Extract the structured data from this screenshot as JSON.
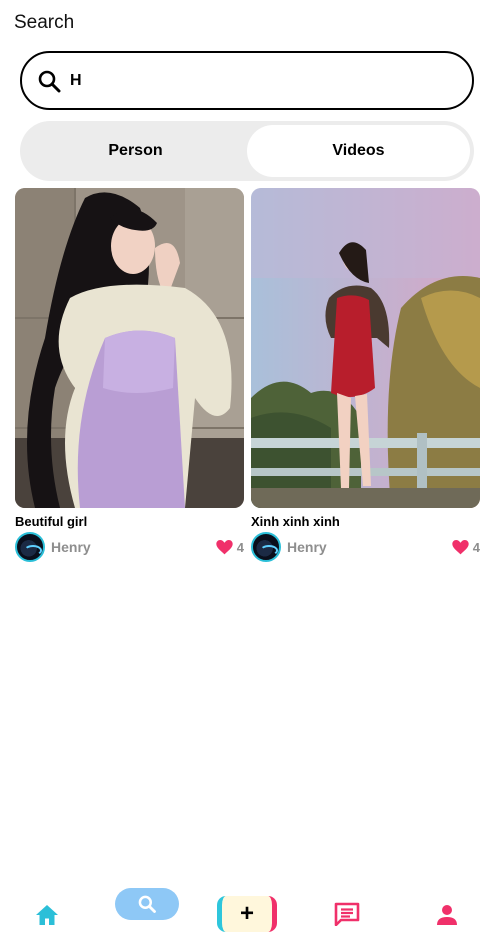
{
  "header": {
    "title": "Search"
  },
  "search": {
    "value": "H",
    "icon": "search-icon"
  },
  "tabs": [
    {
      "label": "Person",
      "active": false
    },
    {
      "label": "Videos",
      "active": true
    }
  ],
  "videos": [
    {
      "title": "Beutiful girl",
      "author": "Henry",
      "likes": "4"
    },
    {
      "title": "Xinh xinh xinh",
      "author": "Henry",
      "likes": "4"
    }
  ],
  "nav": {
    "items": [
      {
        "icon": "home-icon",
        "active": false
      },
      {
        "icon": "search-icon",
        "active": true
      },
      {
        "icon": "plus-icon",
        "glyph": "+",
        "active": false
      },
      {
        "icon": "chat-icon",
        "active": false
      },
      {
        "icon": "profile-icon",
        "active": false
      }
    ]
  },
  "colors": {
    "accent_cyan": "#2bbfd8",
    "accent_pink": "#f0306a",
    "search_active": "#8ec8f6"
  }
}
